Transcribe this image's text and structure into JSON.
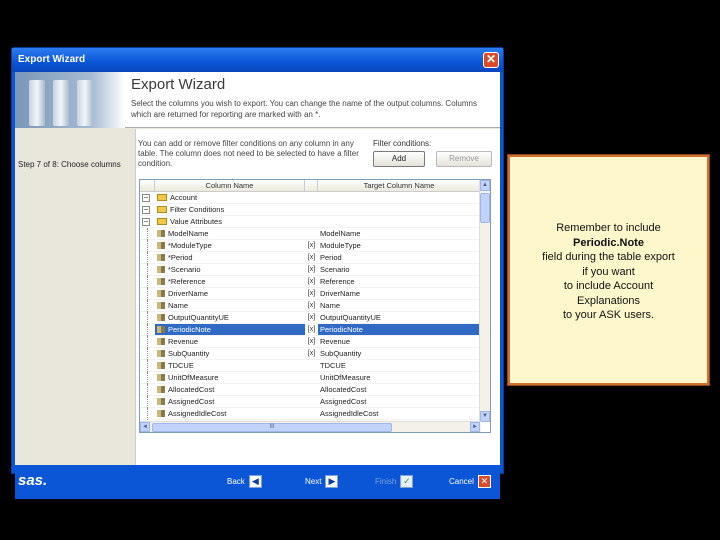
{
  "window": {
    "title": "Export Wizard",
    "close": "✕"
  },
  "header": {
    "title": "Export Wizard",
    "description": "Select the columns you wish to export. You can change the name of the output columns. Columns which are returned for reporting are marked with an *."
  },
  "step": "Step 7 of 8: Choose columns",
  "intro": "You can add or remove filter conditions on any column in any table. The column does not need to be selected to have a filter condition.",
  "filter": {
    "label": "Filter conditions:",
    "add": "Add",
    "remove": "Remove"
  },
  "grid": {
    "col_name": "Column Name",
    "col_target": "Target Column Name",
    "rows": [
      {
        "name": "Account",
        "flag": "",
        "target": "",
        "type": "root"
      },
      {
        "name": "Filter Conditions",
        "flag": "",
        "target": "",
        "type": "folder"
      },
      {
        "name": "Value Attributes",
        "flag": "",
        "target": "",
        "type": "folder"
      },
      {
        "name": "ModelName",
        "flag": "",
        "target": "ModelName",
        "type": "leaf"
      },
      {
        "name": "*ModuleType",
        "flag": "[x]",
        "target": "ModuleType",
        "type": "leaf"
      },
      {
        "name": "*Period",
        "flag": "[x]",
        "target": "Period",
        "type": "leaf"
      },
      {
        "name": "*Scenario",
        "flag": "[x]",
        "target": "Scenario",
        "type": "leaf"
      },
      {
        "name": "*Reference",
        "flag": "[x]",
        "target": "Reference",
        "type": "leaf"
      },
      {
        "name": "DriverName",
        "flag": "[x]",
        "target": "DriverName",
        "type": "leaf"
      },
      {
        "name": "Name",
        "flag": "[x]",
        "target": "Name",
        "type": "leaf"
      },
      {
        "name": "OutputQuantityUE",
        "flag": "[x]",
        "target": "OutputQuantityUE",
        "type": "leaf"
      },
      {
        "name": "PeriodicNote",
        "flag": "[x]",
        "target": "PeriodicNote",
        "type": "leaf",
        "selected": true
      },
      {
        "name": "Revenue",
        "flag": "[x]",
        "target": "Revenue",
        "type": "leaf"
      },
      {
        "name": "SubQuantity",
        "flag": "[x]",
        "target": "SubQuantity",
        "type": "leaf"
      },
      {
        "name": "TDCUE",
        "flag": "",
        "target": "TDCUE",
        "type": "leaf"
      },
      {
        "name": "UnitOfMeasure",
        "flag": "",
        "target": "UnitOfMeasure",
        "type": "leaf"
      },
      {
        "name": "AllocatedCost",
        "flag": "",
        "target": "AllocatedCost",
        "type": "leaf"
      },
      {
        "name": "AssignedCost",
        "flag": "",
        "target": "AssignedCost",
        "type": "leaf"
      },
      {
        "name": "AssignedIdleCost",
        "flag": "",
        "target": "AssignedIdleCost",
        "type": "leaf"
      }
    ],
    "hscroll_label": "III"
  },
  "footer": {
    "logo": "sas.",
    "back": "Back",
    "next": "Next",
    "finish": "Finish",
    "cancel": "Cancel"
  },
  "callout": {
    "line1": "Remember to include",
    "line2": "Periodic.Note",
    "line3": "field during the table export",
    "line4": "if you want",
    "line5": "to include Account",
    "line6": "Explanations",
    "line7": "to your ASK users."
  },
  "colors": {
    "titlebar": "#0a56d6",
    "selection": "#316ac5",
    "callout_bg": "#fff7cc",
    "callout_border": "#d06f2e"
  }
}
